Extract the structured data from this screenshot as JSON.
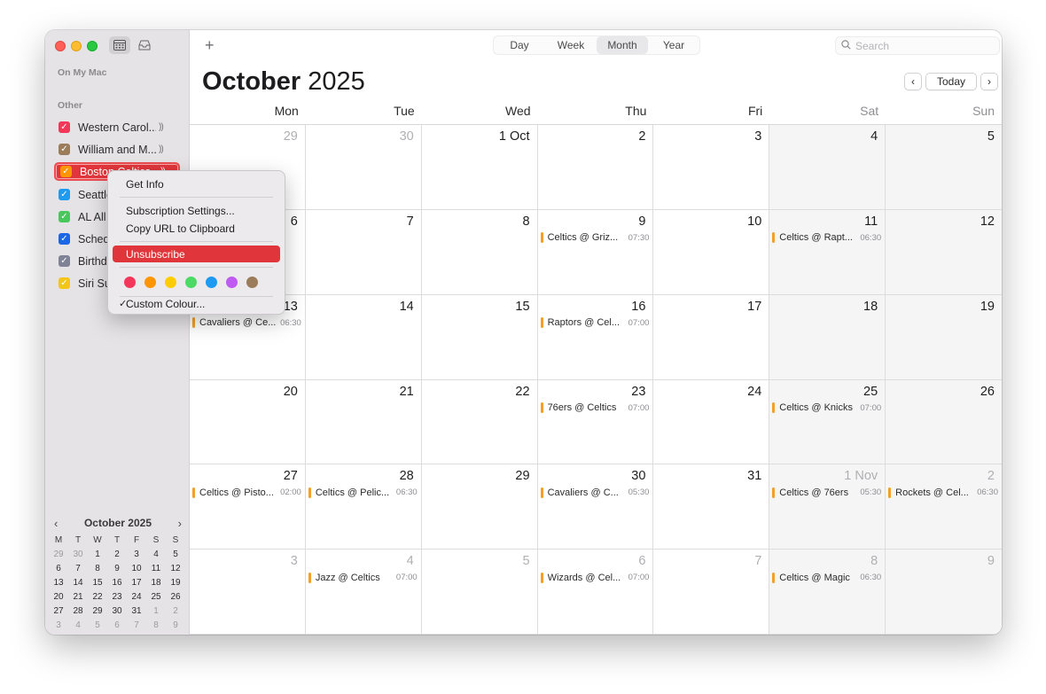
{
  "sidebar": {
    "heading_mac": "On My Mac",
    "heading_other": "Other",
    "calendars": [
      {
        "name": "Western Carol...",
        "color": "#f2375a",
        "broadcast": "))",
        "selected": false
      },
      {
        "name": "William and M...",
        "color": "#9b7d5b",
        "broadcast": "))",
        "selected": false
      },
      {
        "name": "Boston Celtics",
        "color": "#ff9500",
        "broadcast": "))",
        "selected": true
      },
      {
        "name": "Seattle",
        "color": "#1e9bf0",
        "broadcast": "",
        "selected": false
      },
      {
        "name": "AL All",
        "color": "#48c75a",
        "broadcast": "",
        "selected": false
      },
      {
        "name": "Schedule",
        "color": "#1a66e6",
        "broadcast": "",
        "selected": false
      },
      {
        "name": "Birthdays",
        "color": "#7f8395",
        "broadcast": "",
        "selected": false
      },
      {
        "name": "Siri Su",
        "color": "#f5c518",
        "broadcast": "",
        "selected": false
      }
    ],
    "mini_calendar": {
      "title": "October 2025",
      "prev": "‹",
      "next": "›",
      "weekdays": [
        "M",
        "T",
        "W",
        "T",
        "F",
        "S",
        "S"
      ],
      "days": [
        [
          "29",
          "30",
          "1",
          "2",
          "3",
          "4",
          "5"
        ],
        [
          "6",
          "7",
          "8",
          "9",
          "10",
          "11",
          "12"
        ],
        [
          "13",
          "14",
          "15",
          "16",
          "17",
          "18",
          "19"
        ],
        [
          "20",
          "21",
          "22",
          "23",
          "24",
          "25",
          "26"
        ],
        [
          "27",
          "28",
          "29",
          "30",
          "31",
          "1",
          "2"
        ],
        [
          "3",
          "4",
          "5",
          "6",
          "7",
          "8",
          "9"
        ]
      ],
      "dim_first_row": [
        true,
        true,
        false,
        false,
        false,
        false,
        false
      ],
      "dim_fifth_row": [
        false,
        false,
        false,
        false,
        false,
        true,
        true
      ]
    }
  },
  "toolbar": {
    "add_label": "+",
    "views": [
      "Day",
      "Week",
      "Month",
      "Year"
    ],
    "active_view": "Month",
    "search_placeholder": "Search",
    "today_label": "Today",
    "prev_label": "‹",
    "next_label": "›"
  },
  "header": {
    "month_name": "October",
    "year": "2025"
  },
  "weekdays": [
    "Mon",
    "Tue",
    "Wed",
    "Thu",
    "Fri",
    "Sat",
    "Sun"
  ],
  "event_color": "#f4a023",
  "cells": [
    {
      "day": "29",
      "other": true
    },
    {
      "day": "30",
      "other": true
    },
    {
      "day": "1 Oct",
      "other": false
    },
    {
      "day": "2",
      "other": false
    },
    {
      "day": "3",
      "other": false
    },
    {
      "day": "4",
      "other": false
    },
    {
      "day": "5",
      "other": false
    },
    {
      "day": "6",
      "other": false
    },
    {
      "day": "7",
      "other": false
    },
    {
      "day": "8",
      "other": false
    },
    {
      "day": "9",
      "other": false,
      "event": {
        "title": "Celtics @ Griz...",
        "time": "07:30"
      }
    },
    {
      "day": "10",
      "other": false
    },
    {
      "day": "11",
      "other": false,
      "event": {
        "title": "Celtics @ Rapt...",
        "time": "06:30"
      }
    },
    {
      "day": "12",
      "other": false
    },
    {
      "day": "13",
      "other": false,
      "event": {
        "title": "Cavaliers @ Ce...",
        "time": "06:30"
      }
    },
    {
      "day": "14",
      "other": false
    },
    {
      "day": "15",
      "other": false
    },
    {
      "day": "16",
      "other": false,
      "event": {
        "title": "Raptors @ Cel...",
        "time": "07:00"
      }
    },
    {
      "day": "17",
      "other": false
    },
    {
      "day": "18",
      "other": false
    },
    {
      "day": "19",
      "other": false
    },
    {
      "day": "20",
      "other": false
    },
    {
      "day": "21",
      "other": false
    },
    {
      "day": "22",
      "other": false
    },
    {
      "day": "23",
      "other": false,
      "event": {
        "title": "76ers @ Celtics",
        "time": "07:00"
      }
    },
    {
      "day": "24",
      "other": false
    },
    {
      "day": "25",
      "other": false,
      "event": {
        "title": "Celtics @ Knicks",
        "time": "07:00"
      }
    },
    {
      "day": "26",
      "other": false
    },
    {
      "day": "27",
      "other": false,
      "event": {
        "title": "Celtics @ Pisto...",
        "time": "02:00"
      }
    },
    {
      "day": "28",
      "other": false,
      "event": {
        "title": "Celtics @ Pelic...",
        "time": "06:30"
      }
    },
    {
      "day": "29",
      "other": false
    },
    {
      "day": "30",
      "other": false,
      "event": {
        "title": "Cavaliers @ C...",
        "time": "05:30"
      }
    },
    {
      "day": "31",
      "other": false
    },
    {
      "day": "1 Nov",
      "other": true,
      "event": {
        "title": "Celtics @ 76ers",
        "time": "05:30"
      }
    },
    {
      "day": "2",
      "other": true,
      "event": {
        "title": "Rockets @ Cel...",
        "time": "06:30"
      }
    },
    {
      "day": "3",
      "other": true
    },
    {
      "day": "4",
      "other": true,
      "event": {
        "title": "Jazz @ Celtics",
        "time": "07:00"
      }
    },
    {
      "day": "5",
      "other": true
    },
    {
      "day": "6",
      "other": true,
      "event": {
        "title": "Wizards @ Cel...",
        "time": "07:00"
      }
    },
    {
      "day": "7",
      "other": true
    },
    {
      "day": "8",
      "other": true,
      "event": {
        "title": "Celtics @ Magic",
        "time": "06:30"
      }
    },
    {
      "day": "9",
      "other": true
    }
  ],
  "context_menu": {
    "get_info": "Get Info",
    "subscription_settings": "Subscription Settings...",
    "copy_url": "Copy URL to Clipboard",
    "unsubscribe": "Unsubscribe",
    "colors": [
      "#f2375a",
      "#ff9500",
      "#ffcc00",
      "#4cd964",
      "#1e9bf0",
      "#bf5af2",
      "#9b7d5b"
    ],
    "custom_colour": "Custom Colour...",
    "check": "✓"
  }
}
